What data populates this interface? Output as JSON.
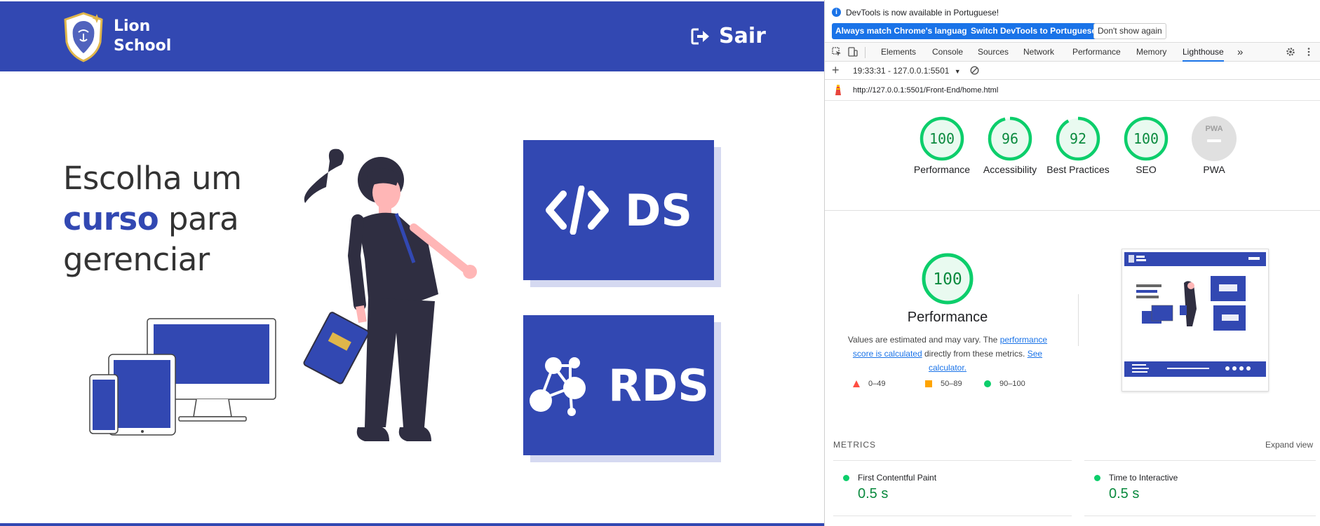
{
  "site": {
    "brand_line1": "Lion",
    "brand_line2": "School",
    "logout_label": "Sair",
    "headline_part1": "Escolha um",
    "headline_highlight": "curso",
    "headline_part2": "para",
    "headline_part3": "gerenciar",
    "courses": [
      {
        "label": "DS",
        "icon": "code-icon"
      },
      {
        "label": "RDS",
        "icon": "network-icon"
      }
    ],
    "colors": {
      "primary": "#3248b2",
      "shadow": "#d5d9f1"
    }
  },
  "devtools": {
    "info_message": "DevTools is now available in Portuguese!",
    "buttons": {
      "match_language": "Always match Chrome's language",
      "switch_portuguese": "Switch DevTools to Portuguese",
      "dont_show": "Don't show again"
    },
    "tabs": [
      "Elements",
      "Console",
      "Sources",
      "Network",
      "Performance",
      "Memory",
      "Lighthouse"
    ],
    "active_tab": "Lighthouse",
    "more_tabs": "»",
    "report_select": "19:33:31 - 127.0.0.1:5501",
    "url": "http://127.0.0.1:5501/Front-End/home.html",
    "categories": [
      {
        "label": "Performance",
        "score": "100"
      },
      {
        "label": "Accessibility",
        "score": "96"
      },
      {
        "label": "Best Practices",
        "score": "92"
      },
      {
        "label": "SEO",
        "score": "100"
      },
      {
        "label": "PWA",
        "score": ""
      }
    ],
    "pwa_badge": "PWA",
    "performance": {
      "score": "100",
      "title": "Performance",
      "desc_text1": "Values are estimated and may vary. The",
      "desc_link1": "performance score is calculated",
      "desc_text2": "directly from these metrics.",
      "desc_link2": "See calculator."
    },
    "legend": {
      "fail": "0–49",
      "average": "50–89",
      "pass": "90–100"
    },
    "metrics_title": "METRICS",
    "expand_view": "Expand view",
    "metrics": [
      {
        "name": "First Contentful Paint",
        "value": "0.5 s"
      },
      {
        "name": "Time to Interactive",
        "value": "0.5 s"
      }
    ],
    "colors": {
      "pass": "#0cce6b",
      "pass_text": "#0a8a3e",
      "average": "#ffa400",
      "fail": "#ff4e42",
      "link": "#1a73e8"
    }
  }
}
